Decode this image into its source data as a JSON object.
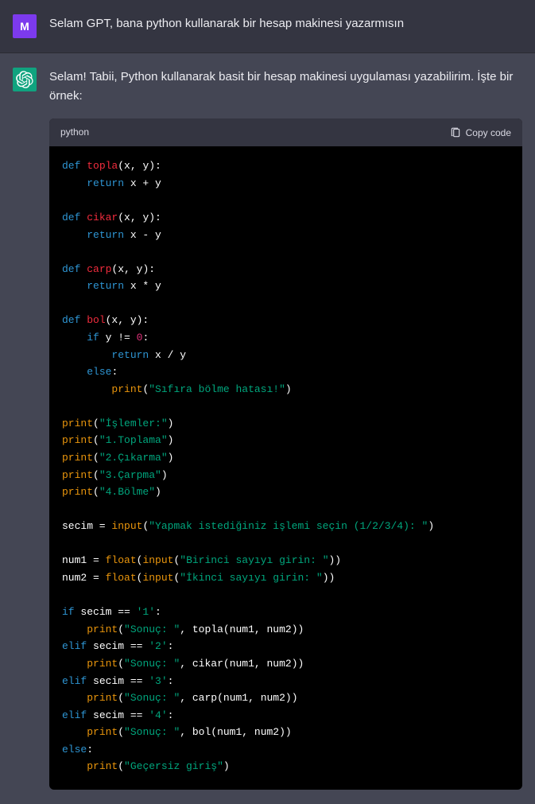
{
  "user": {
    "avatar_letter": "M",
    "text": "Selam GPT, bana python kullanarak bir hesap makinesi yazarmısın"
  },
  "assistant": {
    "intro": "Selam! Tabii, Python kullanarak basit bir hesap makinesi uygulaması yazabilirim. İşte bir örnek:"
  },
  "code": {
    "language": "python",
    "copy_label": "Copy code",
    "kw_def": "def",
    "kw_return": "return",
    "kw_if": "if",
    "kw_else": "else",
    "kw_elif": "elif",
    "fn_topla": "topla",
    "fn_cikar": "cikar",
    "fn_carp": "carp",
    "fn_bol": "bol",
    "bi_print": "print",
    "bi_input": "input",
    "bi_float": "float",
    "num_zero": "0",
    "params_xy": "(x, y):",
    "ret_plus": " x + y",
    "ret_minus": " x - y",
    "ret_times": " x * y",
    "ret_div": " x / y",
    "bol_cond": " y != ",
    "bol_cond_tail": ":",
    "else_colon": ":",
    "str_divzero": "\"Sıfıra bölme hatası!\"",
    "str_islemler": "\"İşlemler:\"",
    "str_op1": "\"1.Toplama\"",
    "str_op2": "\"2.Çıkarma\"",
    "str_op3": "\"3.Çarpma\"",
    "str_op4": "\"4.Bölme\"",
    "secim_lhs": "secim = ",
    "str_prompt": "\"Yapmak istediğiniz işlemi seçin (1/2/3/4): \"",
    "num1_lhs": "num1 = ",
    "num2_lhs": "num2 = ",
    "str_num1": "\"Birinci sayıyı girin: \"",
    "str_num2": "\"İkinci sayıyı girin: \"",
    "cond_secim": " secim == ",
    "str_c1": "'1'",
    "str_c2": "'2'",
    "str_c3": "'3'",
    "str_c4": "'4'",
    "colon": ":",
    "str_sonuc": "\"Sonuç: \"",
    "args_nums": "(num1, num2))",
    "comma_sp": ", ",
    "str_invalid": "\"Geçersiz giriş\"",
    "open_p": "(",
    "close_p": ")",
    "close_pp": "))"
  }
}
